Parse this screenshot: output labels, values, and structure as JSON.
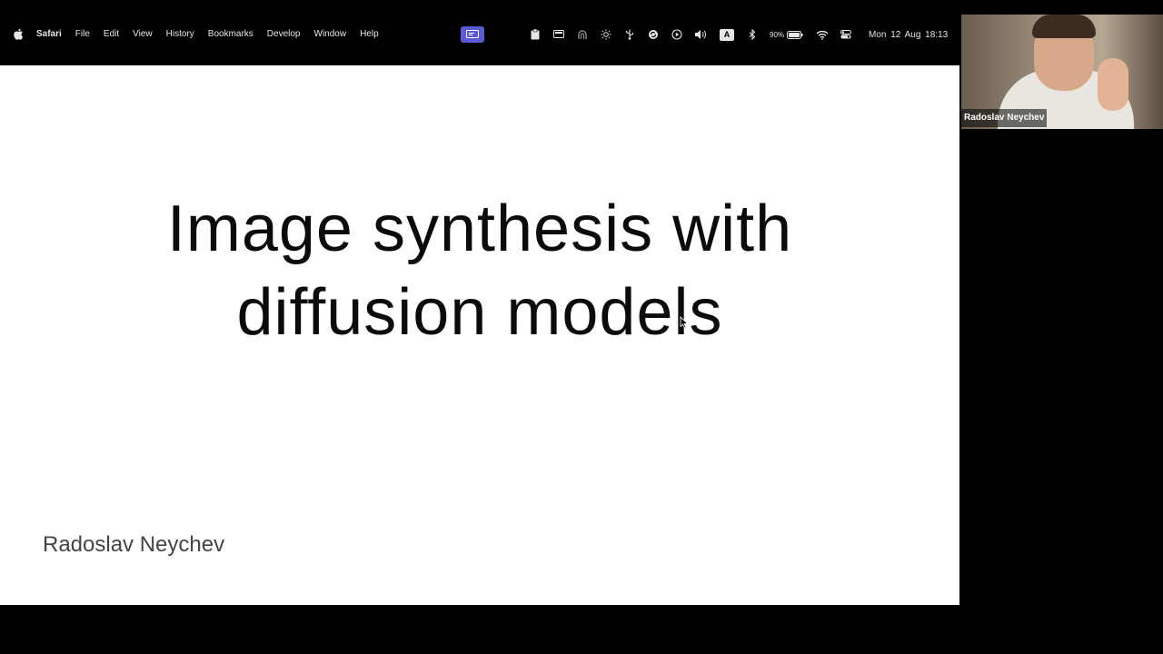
{
  "menubar": {
    "app_name": "Safari",
    "menus": [
      "File",
      "Edit",
      "View",
      "History",
      "Bookmarks",
      "Develop",
      "Window",
      "Help"
    ],
    "battery_percent": "90%",
    "input_source": "A",
    "datetime": "Mon 12 Aug  18:13",
    "icons": [
      "apple-icon",
      "screen-share-icon",
      "clipboard-icon",
      "display-icon",
      "privacy-icon",
      "brightness-icon",
      "usb-icon",
      "sync-icon",
      "play-icon",
      "volume-icon",
      "input-source-icon",
      "bluetooth-icon",
      "battery-icon",
      "wifi-icon",
      "control-center-icon"
    ]
  },
  "slide": {
    "title_line1": "Image synthesis with",
    "title_line2": "diffusion models",
    "author": "Radoslav Neychev"
  },
  "video": {
    "participant_name": "Radoslav Neychev"
  },
  "colors": {
    "background": "#000000",
    "slide_background": "#ffffff",
    "accent": "#5b5bd6"
  }
}
